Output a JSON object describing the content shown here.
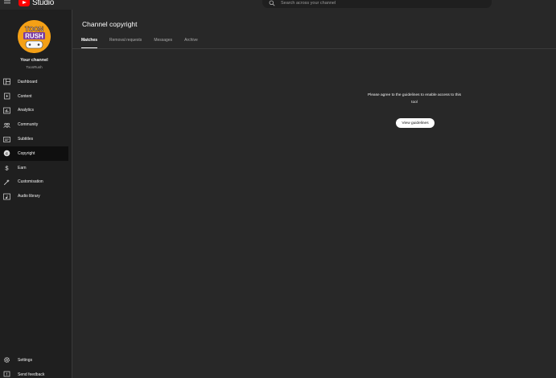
{
  "header": {
    "logo_text": "Studio",
    "search_placeholder": "Search across your channel"
  },
  "channel": {
    "avatar_text_line1": "TOON",
    "avatar_text_line2": "RUSH",
    "title": "Your channel",
    "name": "ToonRush"
  },
  "sidebar": {
    "items": [
      {
        "label": "Dashboard",
        "icon": "dashboard-icon"
      },
      {
        "label": "Content",
        "icon": "content-icon"
      },
      {
        "label": "Analytics",
        "icon": "analytics-icon"
      },
      {
        "label": "Community",
        "icon": "community-icon"
      },
      {
        "label": "Subtitles",
        "icon": "subtitles-icon"
      },
      {
        "label": "Copyright",
        "icon": "copyright-icon",
        "active": true
      },
      {
        "label": "Earn",
        "icon": "earn-icon"
      },
      {
        "label": "Customisation",
        "icon": "customisation-icon"
      },
      {
        "label": "Audio library",
        "icon": "audio-library-icon"
      }
    ],
    "bottom": [
      {
        "label": "Settings",
        "icon": "gear-icon"
      },
      {
        "label": "Send feedback",
        "icon": "feedback-icon"
      }
    ]
  },
  "main": {
    "title": "Channel copyright",
    "tabs": [
      {
        "label": "Matches",
        "active": true
      },
      {
        "label": "Removal requests"
      },
      {
        "label": "Messages"
      },
      {
        "label": "Archive"
      }
    ],
    "empty_message": "Please agree to the guidelines to enable access to this tool",
    "button_label": "View guidelines"
  },
  "colors": {
    "background": "#282828",
    "sidebar": "#1f1f1f",
    "active_item": "#0f0f0f",
    "brand_red": "#ff0000",
    "avatar_orange": "#f4a016"
  }
}
